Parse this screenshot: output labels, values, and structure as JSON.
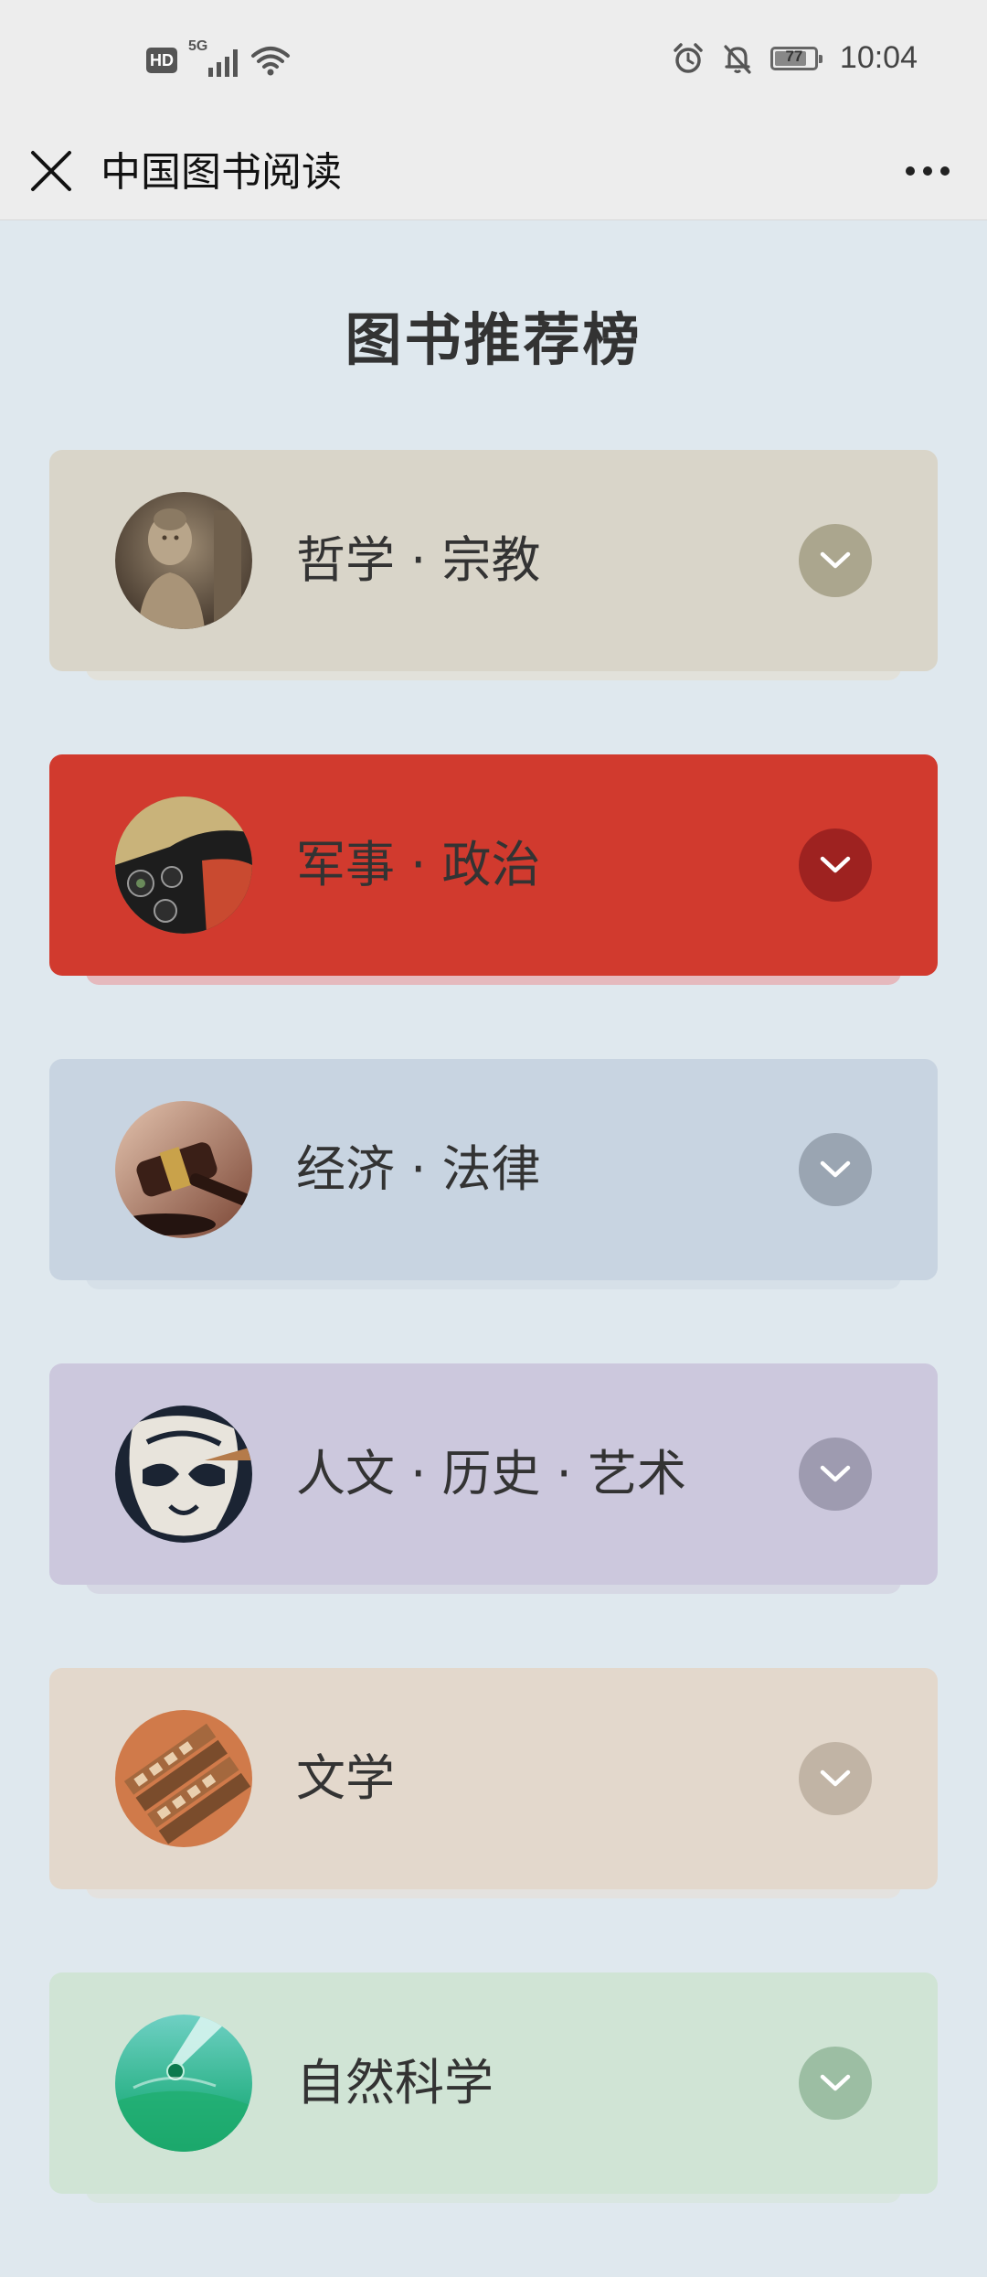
{
  "status_bar": {
    "hd_label": "HD",
    "network_label": "5G",
    "battery_level": "77",
    "time": "10:04"
  },
  "app_bar": {
    "title": "中国图书阅读"
  },
  "page": {
    "heading": "图书推荐榜"
  },
  "categories": [
    {
      "label": "哲学 · 宗教",
      "card_color": "#d9d5c9",
      "shadow_color": "#e2e1da",
      "toggle_color": "#aba68e",
      "thumb": "buddha-statue"
    },
    {
      "label": "军事 · 政治",
      "card_color": "#d13a2e",
      "shadow_color": "#e5b9bd",
      "toggle_color": "#9e2220",
      "thumb": "cockpit-instruments"
    },
    {
      "label": "经济 · 法律",
      "card_color": "#c8d4e1",
      "shadow_color": "#d6e0e8",
      "toggle_color": "#9aa5b2",
      "thumb": "judge-gavel"
    },
    {
      "label": "人文 · 历史 · 艺术",
      "card_color": "#ccc8dd",
      "shadow_color": "#d6d8e4",
      "toggle_color": "#9e9bb0",
      "thumb": "opera-mask"
    },
    {
      "label": "文学",
      "card_color": "#e3d8cc",
      "shadow_color": "#e4e2df",
      "toggle_color": "#c1b4a5",
      "thumb": "movable-type"
    },
    {
      "label": "自然科学",
      "card_color": "#d0e4d5",
      "shadow_color": "#d9e6e1",
      "toggle_color": "#9cbea3",
      "thumb": "test-tube-droplet"
    }
  ]
}
